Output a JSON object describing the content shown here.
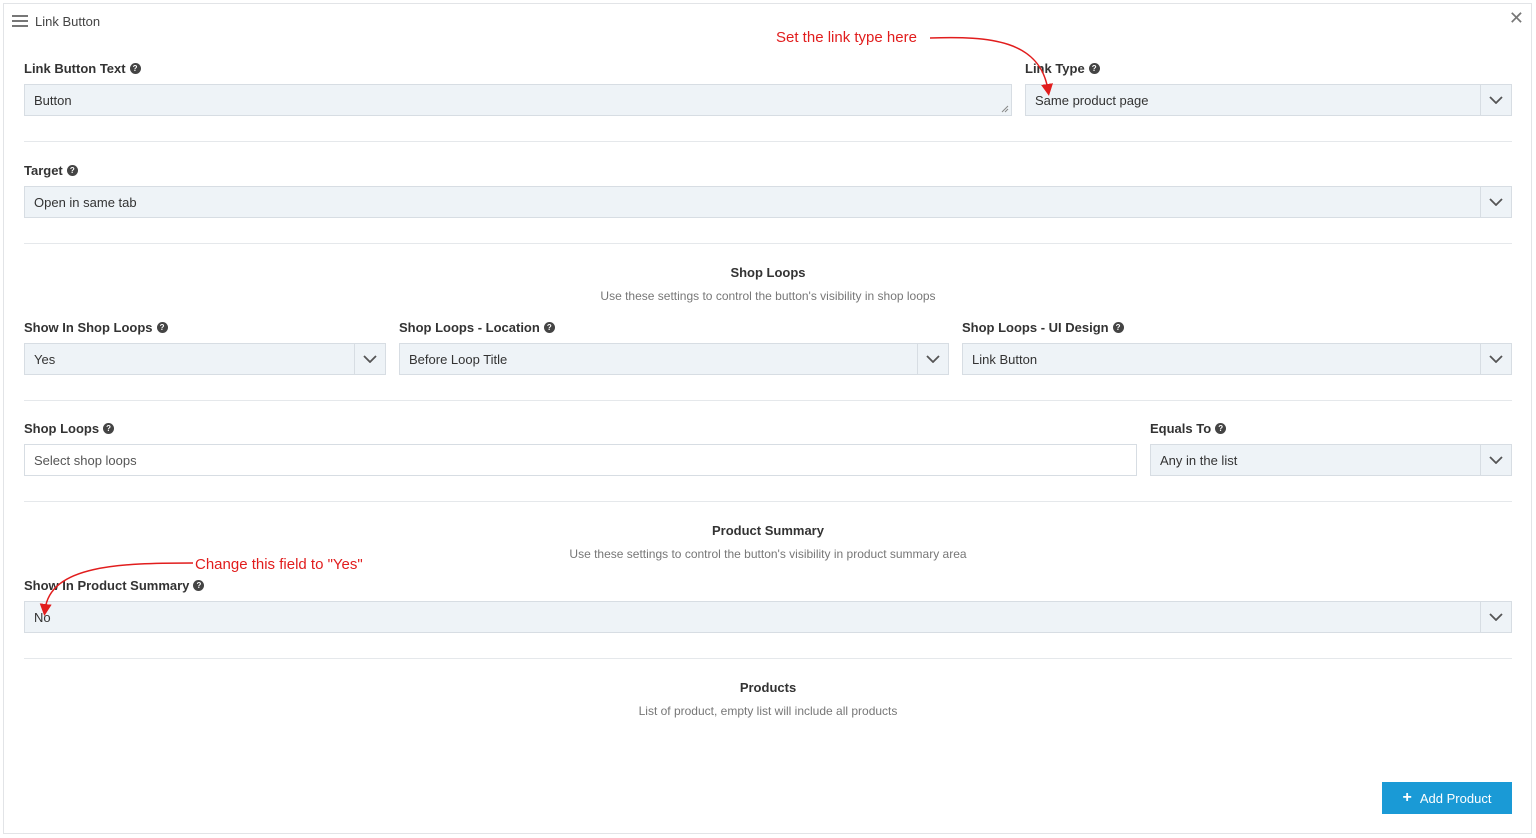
{
  "panel": {
    "title": "Link Button"
  },
  "fields": {
    "link_button_text": {
      "label": "Link Button Text",
      "value": "Button"
    },
    "link_type": {
      "label": "Link Type",
      "value": "Same product page"
    },
    "target": {
      "label": "Target",
      "value": "Open in same tab"
    },
    "show_in_shop_loops": {
      "label": "Show In Shop Loops",
      "value": "Yes"
    },
    "shop_loops_location": {
      "label": "Shop Loops - Location",
      "value": "Before Loop Title"
    },
    "shop_loops_ui_design": {
      "label": "Shop Loops - UI Design",
      "value": "Link Button"
    },
    "shop_loops": {
      "label": "Shop Loops",
      "placeholder": "Select shop loops"
    },
    "equals_to": {
      "label": "Equals To",
      "value": "Any in the list"
    },
    "show_in_product_summary": {
      "label": "Show In Product Summary",
      "value": "No"
    }
  },
  "sections": {
    "shop_loops": {
      "title": "Shop Loops",
      "description": "Use these settings to control the button's visibility in shop loops"
    },
    "product_summary": {
      "title": "Product Summary",
      "description": "Use these settings to control the button's visibility in product summary area"
    },
    "products": {
      "title": "Products",
      "description": "List of product, empty list will include all products"
    }
  },
  "buttons": {
    "add_product": "Add Product"
  },
  "annotations": {
    "link_type_hint": "Set the link type here",
    "product_summary_hint": "Change this field to \"Yes\""
  },
  "icons": {
    "menu": "hamburger-icon",
    "close": "close-icon",
    "help": "question-circle-icon",
    "dropdown": "chevron-down-icon",
    "add": "plus-icon"
  },
  "colors": {
    "accent": "#1a9ad6",
    "annotation": "#e11d1d",
    "field_background": "#eef3f7"
  }
}
